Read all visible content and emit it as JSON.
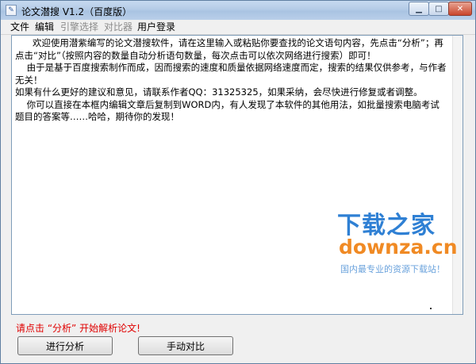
{
  "window": {
    "title": "论文潜搜 V1.2（百度版）"
  },
  "menu": [
    {
      "label": "文件",
      "enabled": true
    },
    {
      "label": "编辑",
      "enabled": true
    },
    {
      "label": "引擎选择",
      "enabled": false
    },
    {
      "label": "对比器",
      "enabled": false
    },
    {
      "label": "用户登录",
      "enabled": true
    }
  ],
  "editor": {
    "content": "      欢迎使用潜紫编写的论文潜搜软件，请在这里输入或粘贴你要查找的论文语句内容，先点击“分析”；再点击“对比”（按照内容的数量自动分析语句数量，每次点击可以依次网络进行搜索）即可！\n    由于是基于百度搜索制作而成，因而搜索的速度和质量依据网络速度而定，搜索的结果仅供参考，与作者无关！\n如果有什么更好的建议和意见，请联系作者QQ：31325325，如果采纳，会尽快进行修复或者调整。\n    你可以直接在本框内编辑文章后复制到WORD内，有人发现了本软件的其他用法，如批量搜索电脑考试题目的答案等……哈哈，期待你的发现！"
  },
  "watermark": {
    "brand": "下载之家",
    "url": "downza.cn",
    "slogan": "国内最专业的资源下载站！"
  },
  "status": {
    "text": "请点击 “分析” 开始解析论文!",
    "color": "#e00000"
  },
  "buttons": {
    "analyze": "进行分析",
    "compare": "手动对比"
  }
}
